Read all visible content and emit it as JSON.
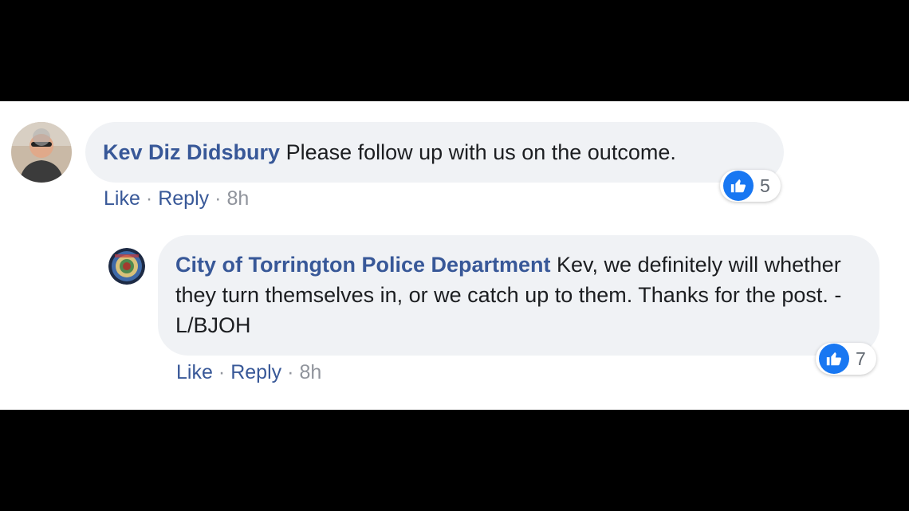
{
  "comments": [
    {
      "author": "Kev Diz Didsbury",
      "text": " Please follow up with us on the outcome.",
      "actions": {
        "like": "Like",
        "reply": "Reply",
        "time": "8h",
        "sep": "·"
      },
      "reaction_count": "5",
      "avatar_icon": "user-photo-avatar"
    },
    {
      "author": "City of Torrington Police Department",
      "text": " Kev, we definitely will whether they turn themselves in, or we catch up to them. Thanks for the post. -L/BJOH",
      "actions": {
        "like": "Like",
        "reply": "Reply",
        "time": "8h",
        "sep": "·"
      },
      "reaction_count": "7",
      "avatar_icon": "police-badge-avatar"
    }
  ],
  "colors": {
    "author": "#385898",
    "bubble": "#f0f2f5",
    "like_blue": "#1877f2",
    "meta_gray": "#90949c"
  }
}
